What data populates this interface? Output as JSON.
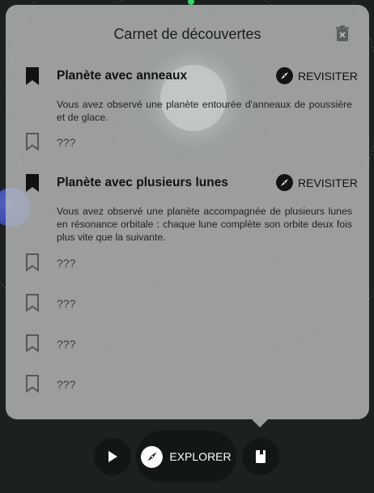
{
  "panel": {
    "title": "Carnet de découvertes",
    "entries": [
      {
        "title": "Planète avec anneaux",
        "action": "REVISITER",
        "description": "Vous avez observé une planète entourée d'anneaux de poussière et de glace."
      },
      {
        "title": "???"
      },
      {
        "title": "Planète avec plusieurs lunes",
        "action": "REVISITER",
        "description": "Vous avez observé une planète accompagnée de plusieurs lunes en résonance orbitale : chaque lune complète son orbite deux fois plus vite que la suivante."
      },
      {
        "title": "???"
      },
      {
        "title": "???"
      },
      {
        "title": "???"
      },
      {
        "title": "???"
      }
    ]
  },
  "controls": {
    "explore_label": "EXPLORER"
  },
  "icons": {
    "bookmark_filled": "bookmark-filled-icon",
    "bookmark_outline": "bookmark-outline-icon",
    "compass": "compass-icon",
    "trash": "trash-icon",
    "play": "play-icon",
    "book": "book-icon"
  },
  "colors": {
    "panel_bg": "#b7bab9",
    "button_dark": "#121615",
    "sun": "#e3fff6",
    "blue_planet": "#4054cc"
  }
}
